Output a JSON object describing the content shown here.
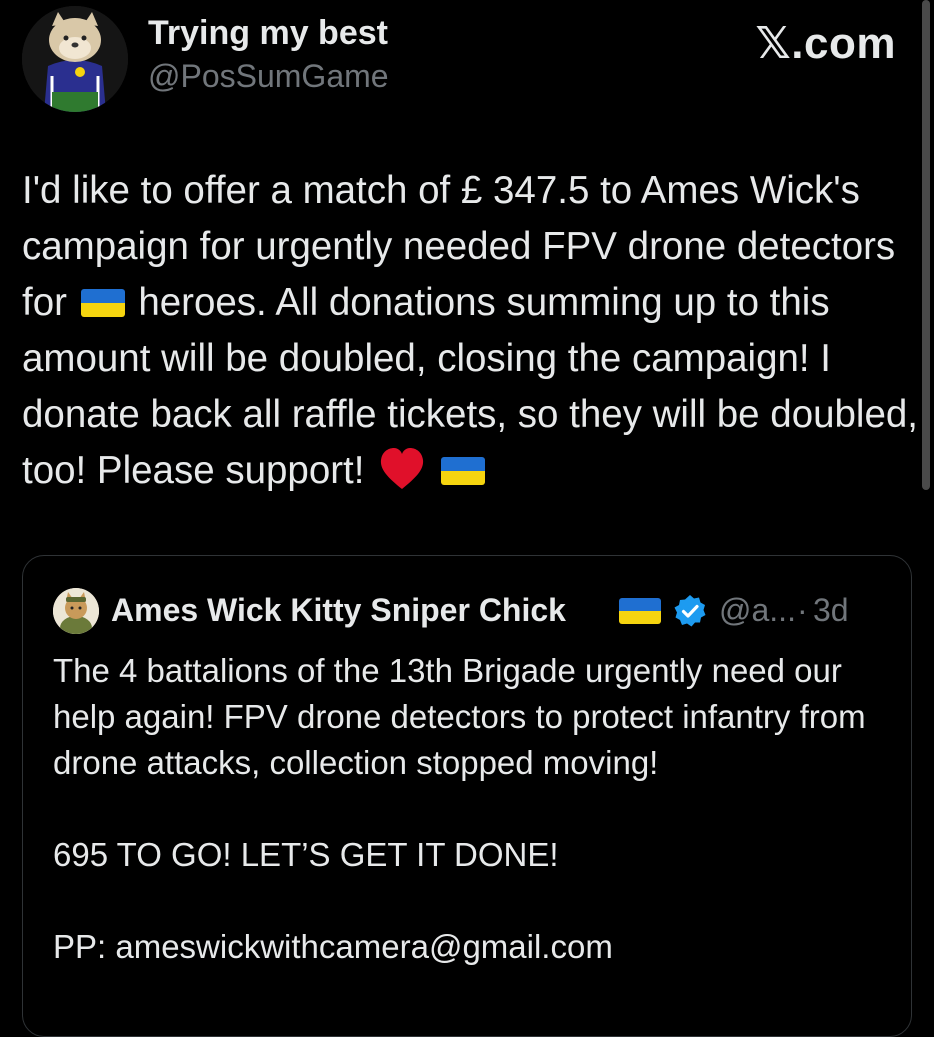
{
  "author": {
    "display_name": "Trying my best",
    "handle": "@PosSumGame"
  },
  "watermark": "𝕏.com",
  "tweet": {
    "text_part1": "I'd like to offer a match of £ 347.5 to Ames Wick's campaign for urgently needed FPV drone detectors for",
    "text_part2": "heroes. All donations summing up to this amount will be doubled, closing the campaign! I donate back all raffle tickets, so they will be doubled, too! Please support!"
  },
  "quoted": {
    "display_name": "Ames Wick Kitty Sniper Chick",
    "handle": "@a...",
    "separator": "·",
    "time": "3d",
    "paragraph1": "The 4 battalions of the 13th Brigade urgently need our help again! FPV drone detectors to protect infantry from drone attacks, collection stopped moving!",
    "paragraph2": "695 TO GO! LET’S GET IT DONE!",
    "paragraph3": "PP: ameswickwithcamera@gmail.com"
  },
  "icons": {
    "flag": "ukraine-flag-icon",
    "heart": "red-heart-icon",
    "verified": "verified-badge-icon"
  },
  "colors": {
    "background": "#000000",
    "text": "#e7e9ea",
    "secondary_text": "#71767b",
    "verified": "#1d9bf0",
    "heart": "#e0102a",
    "flag_blue": "#1f6fd1",
    "flag_yellow": "#f5d40f",
    "card_border": "#2f3336"
  }
}
